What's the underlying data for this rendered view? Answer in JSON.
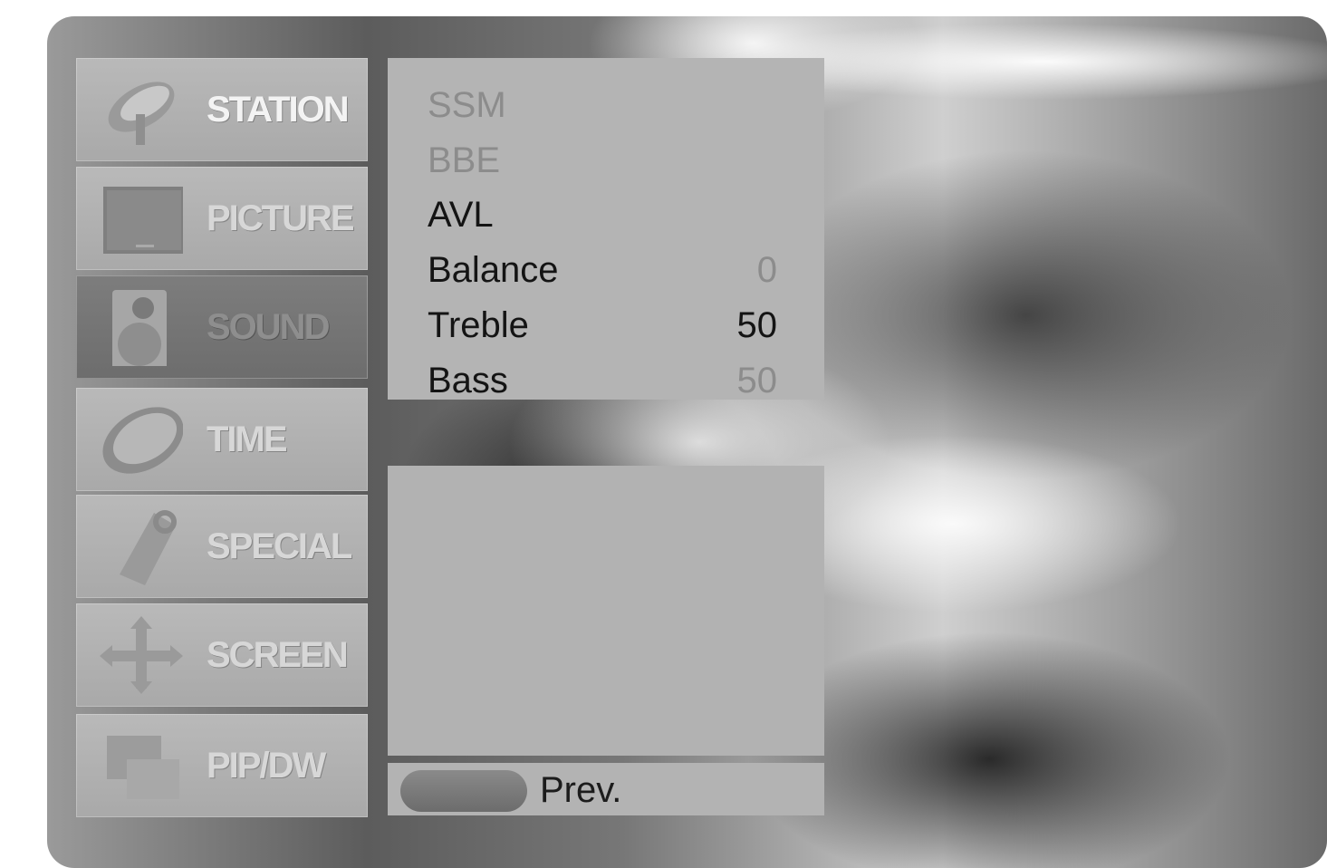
{
  "sidebar": {
    "items": [
      {
        "label": "STATION",
        "icon": "satellite-dish-icon",
        "active": false
      },
      {
        "label": "PICTURE",
        "icon": "monitor-icon",
        "active": false
      },
      {
        "label": "SOUND",
        "icon": "speaker-icon",
        "active": true
      },
      {
        "label": "TIME",
        "icon": "clock-icon",
        "active": false
      },
      {
        "label": "SPECIAL",
        "icon": "tag-icon",
        "active": false
      },
      {
        "label": "SCREEN",
        "icon": "four-way-arrows-icon",
        "active": false
      },
      {
        "label": "PIP/DW",
        "icon": "picture-in-picture-icon",
        "active": false
      }
    ]
  },
  "submenu": {
    "items": [
      {
        "label": "SSM",
        "value": ""
      },
      {
        "label": "BBE",
        "value": ""
      },
      {
        "label": "AVL",
        "value": ""
      },
      {
        "label": "Balance",
        "value": "0"
      },
      {
        "label": "Treble",
        "value": "50"
      },
      {
        "label": "Bass",
        "value": "50"
      }
    ]
  },
  "footer": {
    "prev_label": "Prev."
  }
}
